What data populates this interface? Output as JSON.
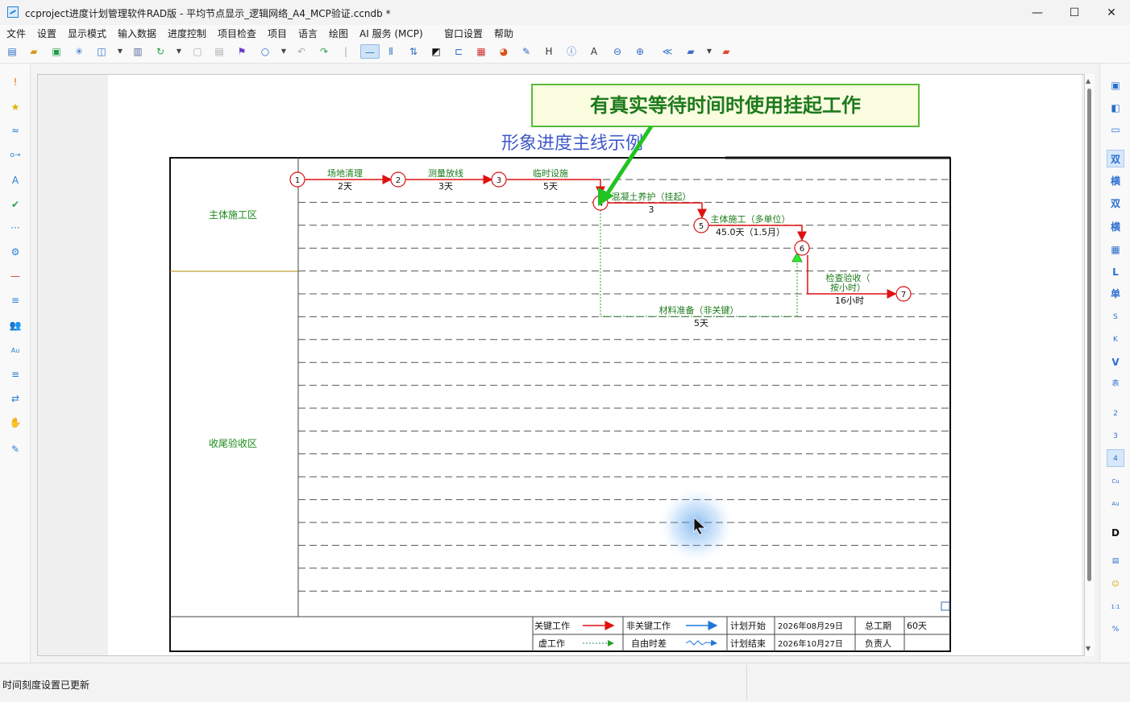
{
  "window": {
    "title": "ccproject进度计划管理软件RAD版 - 平均节点显示_逻辑网络_A4_MCP验证.ccndb *",
    "minimize": "—",
    "maximize": "☐",
    "close": "✕"
  },
  "menu": [
    "文件",
    "设置",
    "显示模式",
    "输入数据",
    "进度控制",
    "项目检查",
    "项目",
    "语言",
    "绘图",
    "AI 服务 (MCP)",
    "窗口设置",
    "帮助"
  ],
  "toolbar_icons": [
    "new-icon",
    "open-icon",
    "save-icon",
    "star-burst-icon",
    "export-icon",
    "dropdown-icon",
    "print-icon",
    "refresh-icon",
    "dropdown-icon",
    "copy-icon",
    "paste-icon",
    "format-icon",
    "search-icon",
    "dropdown-icon",
    "undo-icon",
    "redo-icon",
    "separator-icon",
    "line-tool-icon",
    "bar-tool-icon",
    "sort-icon",
    "contrast-icon",
    "link-icon",
    "check-icon",
    "palette-icon",
    "edit-icon",
    "h-icon",
    "info-icon",
    "text-icon",
    "zoom-out-icon",
    "zoom-in-icon",
    "collapse-icon",
    "folder-icon",
    "dropdown-icon",
    "folder-red-icon"
  ],
  "left_tools": [
    "!",
    "★",
    "≈",
    "o→",
    "A",
    "✔",
    "···",
    "⚙",
    "—",
    "≡",
    "👥",
    "Au",
    "≡",
    "⇄",
    "✋",
    "✎"
  ],
  "right_tools": [
    "▣",
    "◧",
    "▭",
    "双",
    "横",
    "双",
    "横",
    "▦",
    "L",
    "单",
    "S",
    "K",
    "V",
    "表",
    "2",
    "3",
    "4",
    "Cu",
    "Au",
    "D",
    "▤",
    "☺",
    "1:1",
    "%"
  ],
  "diagram": {
    "callout": "有真实等待时间时使用挂起工作",
    "title": "形象进度主线示例",
    "zones": [
      "主体施工区",
      "收尾验收区"
    ],
    "nodes": [
      "1",
      "2",
      "3",
      "4",
      "5",
      "6",
      "7"
    ],
    "activities": [
      {
        "name": "场地清理",
        "duration": "2天"
      },
      {
        "name": "测量放线",
        "duration": "3天"
      },
      {
        "name": "临时设施",
        "duration": "5天"
      },
      {
        "name": "混凝土养护（挂起）",
        "duration": "3"
      },
      {
        "name": "主体施工（多单位）",
        "duration": "45.0天（1.5月）"
      },
      {
        "name": "检查验收（",
        "name2": "按小时）",
        "duration": "16小时"
      },
      {
        "name": "材料准备（非关键）",
        "duration": "5天"
      }
    ],
    "legend": {
      "critical": "关键工作",
      "noncritical": "非关键工作",
      "dummy": "虚工作",
      "float": "自由时差",
      "plan_start_label": "计划开始",
      "plan_start": "2026年08月29日",
      "plan_end_label": "计划结束",
      "plan_end": "2026年10月27日",
      "total_label": "总工期",
      "total": "60天",
      "owner_label": "负责人",
      "owner": ""
    }
  },
  "status": {
    "message": "时间刻度设置已更新"
  },
  "colors": {
    "critical": "#e01010",
    "noncritical": "#1e78d6",
    "dummy": "#2aa02a",
    "callout_border": "#58b83a",
    "callout_bg": "#fbfde0",
    "callout_text": "#1d7a1d",
    "title": "#3f59c9",
    "zone_text": "#1a8a1a"
  }
}
